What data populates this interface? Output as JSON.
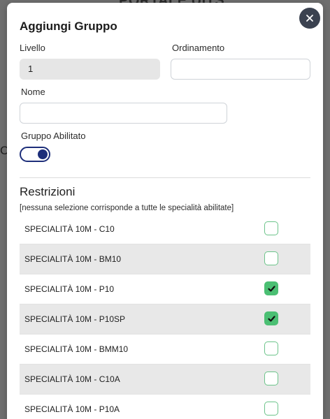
{
  "backdrop": {
    "title_fragment": "PORTALE UITS.",
    "edge_fragment": "C"
  },
  "modal": {
    "title": "Aggiungi Gruppo",
    "close_icon": "close-icon",
    "fields": {
      "livello": {
        "label": "Livello",
        "value": "1",
        "readonly": true
      },
      "ordinamento": {
        "label": "Ordinamento",
        "value": ""
      },
      "nome": {
        "label": "Nome",
        "value": ""
      },
      "abilitato": {
        "label": "Gruppo Abilitato",
        "checked": true
      }
    },
    "restrizioni": {
      "title": "Restrizioni",
      "note": "[nessuna selezione corrisponde a tutte le specialità abilitate]",
      "items": [
        {
          "label": "SPECIALITÀ 10M - C10",
          "checked": false
        },
        {
          "label": "SPECIALITÀ 10M - BM10",
          "checked": false
        },
        {
          "label": "SPECIALITÀ 10M - P10",
          "checked": true
        },
        {
          "label": "SPECIALITÀ 10M - P10SP",
          "checked": true
        },
        {
          "label": "SPECIALITÀ 10M - BMM10",
          "checked": false
        },
        {
          "label": "SPECIALITÀ 10M - C10A",
          "checked": false
        },
        {
          "label": "SPECIALITÀ 10M - P10A",
          "checked": false
        }
      ]
    }
  },
  "colors": {
    "toggle_accent": "#1d2e7a",
    "check_on": "#4bbf73",
    "check_border": "#6cc48a",
    "close_bg": "#3b4250"
  }
}
